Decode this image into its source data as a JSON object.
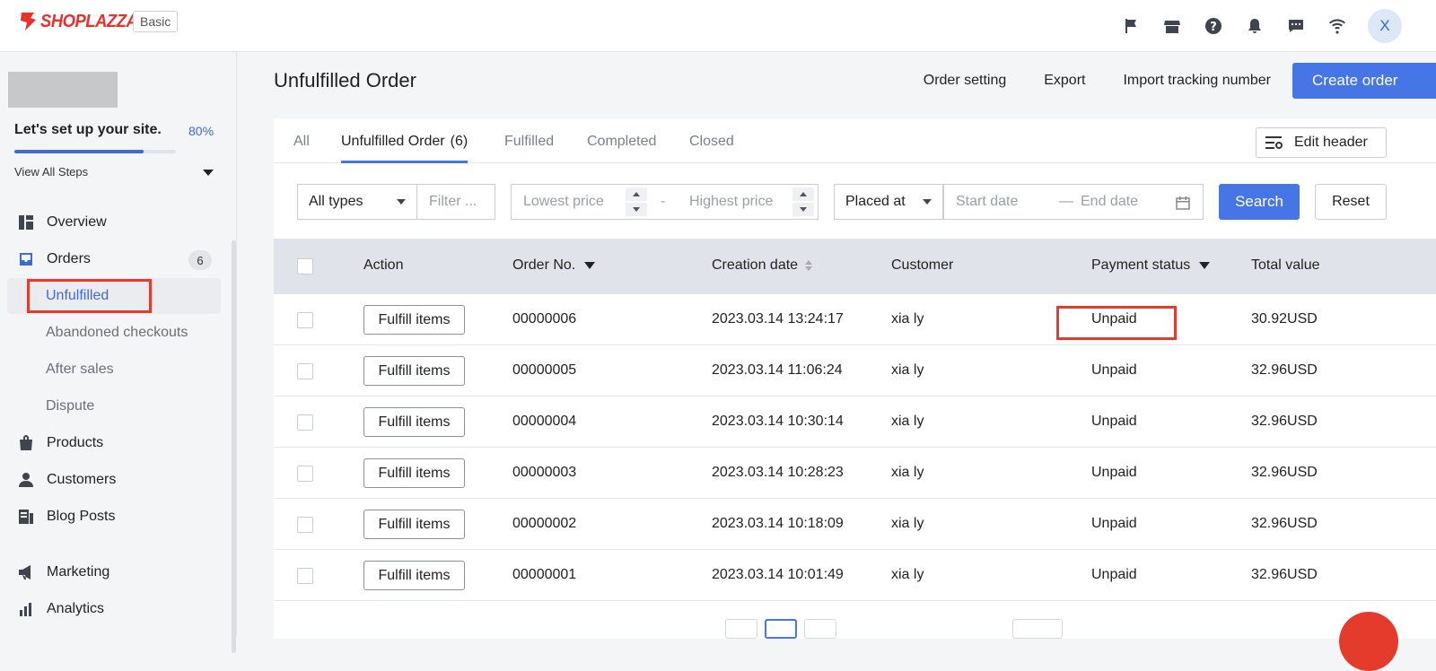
{
  "topbar": {
    "brand": "SHOPLAZZA",
    "plan": "Basic",
    "avatar_initial": "X",
    "icons": [
      "flag-icon",
      "store-icon",
      "help-icon",
      "bell-icon",
      "chat-icon",
      "wifi-icon"
    ]
  },
  "sidebar": {
    "setup_title": "Let's set up your site.",
    "setup_percent": "80%",
    "setup_progress": 0.8,
    "view_steps": "View All Steps",
    "nav": {
      "overview": "Overview",
      "orders": "Orders",
      "orders_count": "6",
      "products": "Products",
      "customers": "Customers",
      "blog_posts": "Blog Posts",
      "marketing": "Marketing",
      "analytics": "Analytics"
    },
    "orders_sub": {
      "unfulfilled": "Unfulfilled",
      "abandoned": "Abandoned checkouts",
      "after_sales": "After sales",
      "dispute": "Dispute"
    }
  },
  "header": {
    "title": "Unfulfilled Order",
    "order_setting": "Order setting",
    "export": "Export",
    "import_tracking": "Import tracking number",
    "create_order": "Create order"
  },
  "tabs": {
    "all": "All",
    "unfulfilled": "Unfulfilled Order",
    "unfulfilled_count": "(6)",
    "fulfilled": "Fulfilled",
    "completed": "Completed",
    "closed": "Closed",
    "edit_header": "Edit header"
  },
  "filters": {
    "type_select": "All types",
    "filter_placeholder": "Filter ...",
    "lowest_price": "Lowest price",
    "price_sep": "-",
    "highest_price": "Highest price",
    "date_select": "Placed at",
    "start_date": "Start date",
    "date_sep": "—",
    "end_date": "End date",
    "search": "Search",
    "reset": "Reset"
  },
  "table": {
    "columns": {
      "action": "Action",
      "order_no": "Order No.",
      "creation_date": "Creation date",
      "customer": "Customer",
      "payment_status": "Payment status",
      "total_value": "Total value"
    },
    "action_label": "Fulfill items",
    "rows": [
      {
        "order_no": "00000006",
        "date": "2023.03.14 13:24:17",
        "customer": "xia ly",
        "payment": "Unpaid",
        "total": "30.92USD"
      },
      {
        "order_no": "00000005",
        "date": "2023.03.14 11:06:24",
        "customer": "xia ly",
        "payment": "Unpaid",
        "total": "32.96USD"
      },
      {
        "order_no": "00000004",
        "date": "2023.03.14 10:30:14",
        "customer": "xia ly",
        "payment": "Unpaid",
        "total": "32.96USD"
      },
      {
        "order_no": "00000003",
        "date": "2023.03.14 10:28:23",
        "customer": "xia ly",
        "payment": "Unpaid",
        "total": "32.96USD"
      },
      {
        "order_no": "00000002",
        "date": "2023.03.14 10:18:09",
        "customer": "xia ly",
        "payment": "Unpaid",
        "total": "32.96USD"
      },
      {
        "order_no": "00000001",
        "date": "2023.03.14 10:01:49",
        "customer": "xia ly",
        "payment": "Unpaid",
        "total": "32.96USD"
      }
    ]
  },
  "colors": {
    "accent": "#4675e6",
    "brand": "#e8312a",
    "highlight": "#e53b2c"
  }
}
